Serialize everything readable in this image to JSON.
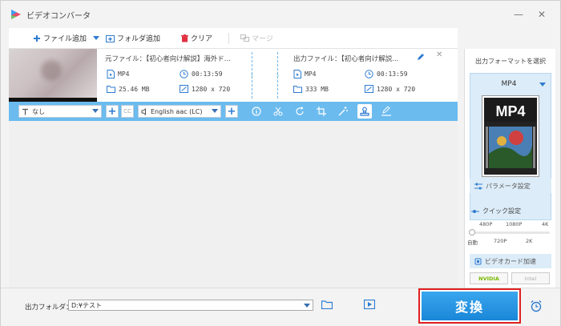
{
  "app": {
    "title": "ビデオコンバータ"
  },
  "toolbar": {
    "add_file": "ファイル追加",
    "add_folder": "フォルダ追加",
    "clear": "クリア",
    "merge": "マージ"
  },
  "item": {
    "source_label": "元ファイル：【初心者向け解説】海外ド...",
    "source_format": "MP4",
    "source_duration": "00:13:59",
    "source_size": "25.46 MB",
    "source_resolution": "1280 x 720",
    "output_label": "出力ファイル：【初心者向け解説...",
    "output_format": "MP4",
    "output_duration": "00:13:59",
    "output_size": "333 MB",
    "output_resolution": "1280 x 720"
  },
  "editbar": {
    "subtitle_value": "なし",
    "audio_value": "English aac (LC)"
  },
  "right_panel": {
    "heading": "出力フォーマットを選択",
    "format": "MP4",
    "format_icon_text": "MP4",
    "params_label": "パラメータ設定",
    "quick_label": "クイック設定",
    "quality_top": [
      "480P",
      "1080P",
      "4K"
    ],
    "quality_bottom": [
      "自動",
      "720P",
      "2K"
    ],
    "gpu_label": "ビデオカード加速",
    "gpu_vendors": [
      "NVIDIA",
      "Intel"
    ]
  },
  "bottom": {
    "output_folder_label": "出力フォルダ：",
    "output_folder_value": "D:¥テスト",
    "convert_label": "変換"
  },
  "colors": {
    "accent": "#2f7bd0",
    "edit_bar": "#6bbbee",
    "convert": "#1a86d8",
    "highlight_border": "#e02020"
  }
}
